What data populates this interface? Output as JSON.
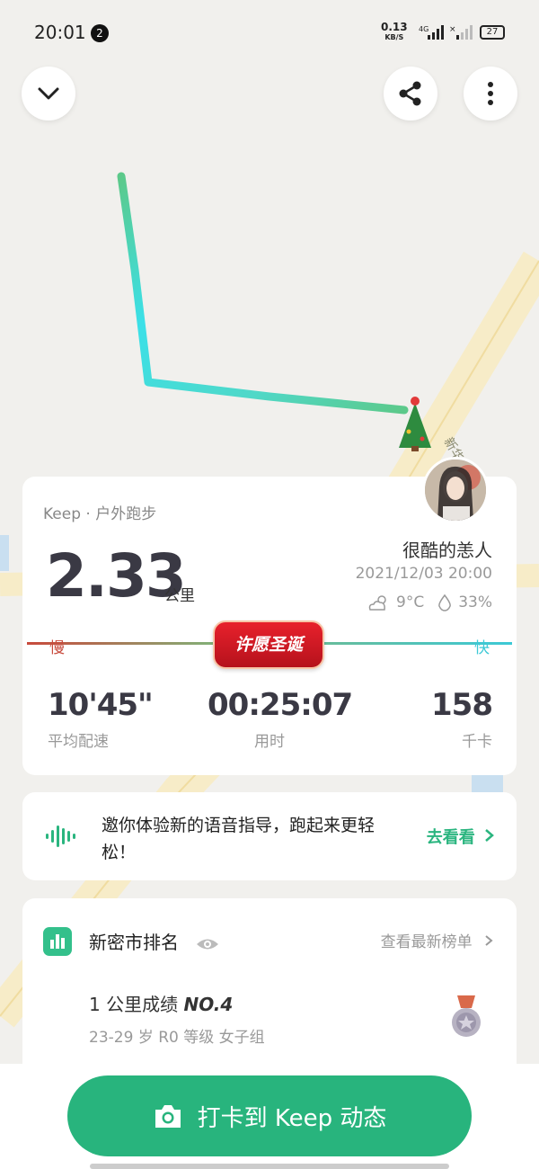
{
  "status_bar": {
    "time": "20:01",
    "notification_count": "2",
    "net_speed": "0.13",
    "net_speed_unit": "KB/S",
    "network": "4G",
    "battery": "27"
  },
  "map": {
    "street_label": "新华"
  },
  "workout": {
    "subtitle": "Keep · 户外跑步",
    "distance": "2.33",
    "distance_unit": "公里",
    "username": "很酷的恙人",
    "datetime": "2021/12/03 20:00",
    "temperature": "9°C",
    "humidity": "33%",
    "pace_slow_label": "慢",
    "pace_fast_label": "快",
    "promo_badge": "许愿圣诞",
    "stats": [
      {
        "value": "10'45\"",
        "label": "平均配速"
      },
      {
        "value": "00:25:07",
        "label": "用时"
      },
      {
        "value": "158",
        "label": "千卡"
      }
    ]
  },
  "voice_promo": {
    "text": "邀你体验新的语音指导，跑起来更轻松！",
    "link": "去看看"
  },
  "ranking": {
    "title": "新密市排名",
    "more_link": "查看最新榜单",
    "result_prefix": "1 公里成绩",
    "result_rank": "NO.4",
    "group": "23-29 岁 R0 等级 女子组"
  },
  "checkin_button": "打卡到 Keep 动态",
  "colors": {
    "brand_green": "#28b47d",
    "route_start": "#3be0e8",
    "route_end": "#5cc98a",
    "pace_slow": "#c84a3c",
    "pace_fast": "#3cc9d6",
    "badge_red": "#e8212c"
  }
}
